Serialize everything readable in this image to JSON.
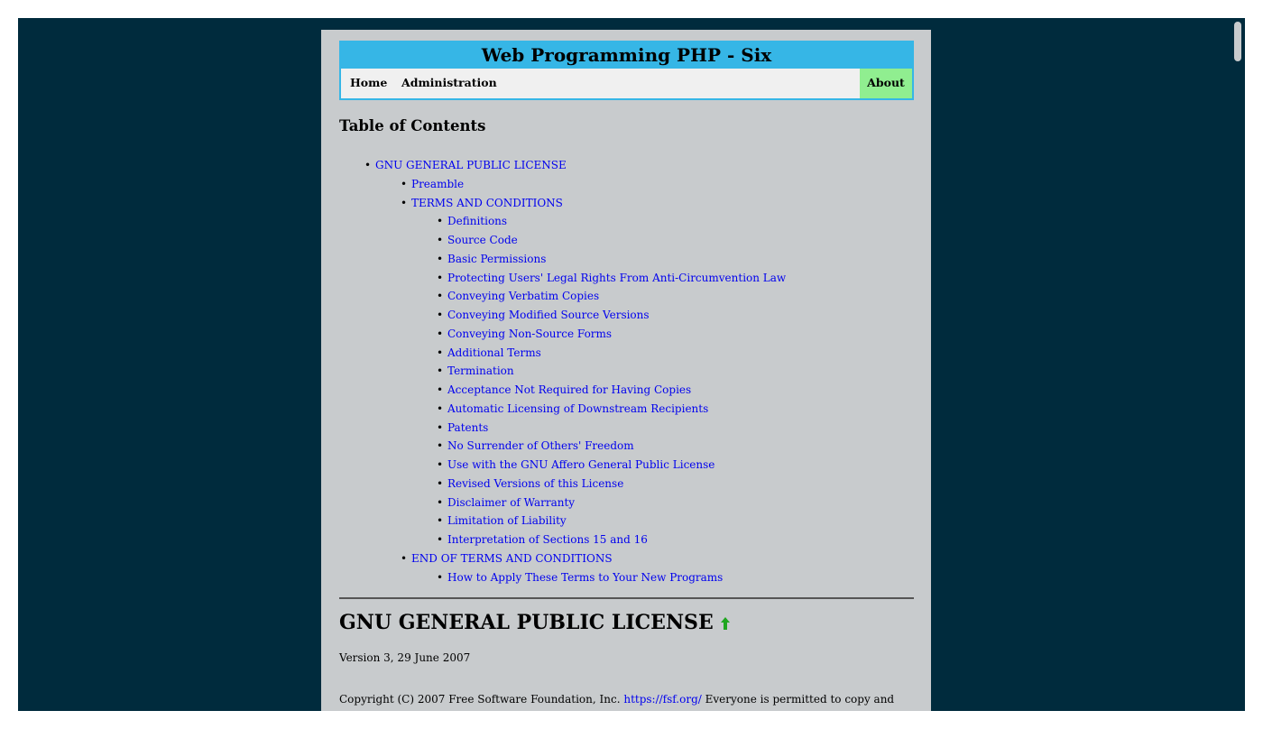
{
  "header": {
    "title": "Web Programming PHP - Six",
    "nav": {
      "home": "Home",
      "administration": "Administration",
      "about": "About"
    },
    "title_bg": "#36b6e6",
    "about_bg": "#90ee90"
  },
  "toc": {
    "heading": "Table of Contents",
    "items": [
      "GNU GENERAL PUBLIC LICENSE",
      "Preamble",
      "TERMS AND CONDITIONS",
      "Definitions",
      "Source Code",
      "Basic Permissions",
      "Protecting Users' Legal Rights From Anti-Circumvention Law",
      "Conveying Verbatim Copies",
      "Conveying Modified Source Versions",
      "Conveying Non-Source Forms",
      "Additional Terms",
      "Termination",
      "Acceptance Not Required for Having Copies",
      "Automatic Licensing of Downstream Recipients",
      "Patents",
      "No Surrender of Others' Freedom",
      "Use with the GNU Affero General Public License",
      "Revised Versions of this License",
      "Disclaimer of Warranty",
      "Limitation of Liability",
      "Interpretation of Sections 15 and 16",
      "END OF TERMS AND CONDITIONS",
      "How to Apply These Terms to Your New Programs"
    ]
  },
  "content": {
    "section_title": "GNU GENERAL PUBLIC LICENSE",
    "up_icon": "green-up-arrow-icon",
    "version": "Version 3, 29 June 2007",
    "copyright_prefix": "Copyright (C) 2007 Free Software Foundation, Inc.",
    "copyright_link": "https://fsf.org/",
    "copyright_suffix": "Everyone is permitted to copy and distribute verbatim copies of this license document, but changing it is not allowed."
  }
}
